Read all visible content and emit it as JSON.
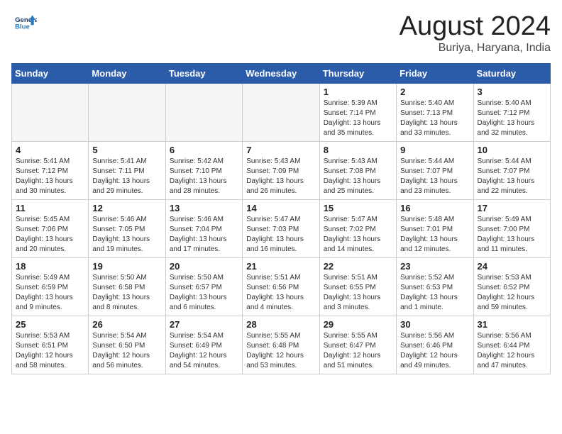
{
  "header": {
    "logo_line1": "General",
    "logo_line2": "Blue",
    "month_title": "August 2024",
    "location": "Buriya, Haryana, India"
  },
  "weekdays": [
    "Sunday",
    "Monday",
    "Tuesday",
    "Wednesday",
    "Thursday",
    "Friday",
    "Saturday"
  ],
  "weeks": [
    [
      {
        "day": "",
        "info": ""
      },
      {
        "day": "",
        "info": ""
      },
      {
        "day": "",
        "info": ""
      },
      {
        "day": "",
        "info": ""
      },
      {
        "day": "1",
        "info": "Sunrise: 5:39 AM\nSunset: 7:14 PM\nDaylight: 13 hours\nand 35 minutes."
      },
      {
        "day": "2",
        "info": "Sunrise: 5:40 AM\nSunset: 7:13 PM\nDaylight: 13 hours\nand 33 minutes."
      },
      {
        "day": "3",
        "info": "Sunrise: 5:40 AM\nSunset: 7:12 PM\nDaylight: 13 hours\nand 32 minutes."
      }
    ],
    [
      {
        "day": "4",
        "info": "Sunrise: 5:41 AM\nSunset: 7:12 PM\nDaylight: 13 hours\nand 30 minutes."
      },
      {
        "day": "5",
        "info": "Sunrise: 5:41 AM\nSunset: 7:11 PM\nDaylight: 13 hours\nand 29 minutes."
      },
      {
        "day": "6",
        "info": "Sunrise: 5:42 AM\nSunset: 7:10 PM\nDaylight: 13 hours\nand 28 minutes."
      },
      {
        "day": "7",
        "info": "Sunrise: 5:43 AM\nSunset: 7:09 PM\nDaylight: 13 hours\nand 26 minutes."
      },
      {
        "day": "8",
        "info": "Sunrise: 5:43 AM\nSunset: 7:08 PM\nDaylight: 13 hours\nand 25 minutes."
      },
      {
        "day": "9",
        "info": "Sunrise: 5:44 AM\nSunset: 7:07 PM\nDaylight: 13 hours\nand 23 minutes."
      },
      {
        "day": "10",
        "info": "Sunrise: 5:44 AM\nSunset: 7:07 PM\nDaylight: 13 hours\nand 22 minutes."
      }
    ],
    [
      {
        "day": "11",
        "info": "Sunrise: 5:45 AM\nSunset: 7:06 PM\nDaylight: 13 hours\nand 20 minutes."
      },
      {
        "day": "12",
        "info": "Sunrise: 5:46 AM\nSunset: 7:05 PM\nDaylight: 13 hours\nand 19 minutes."
      },
      {
        "day": "13",
        "info": "Sunrise: 5:46 AM\nSunset: 7:04 PM\nDaylight: 13 hours\nand 17 minutes."
      },
      {
        "day": "14",
        "info": "Sunrise: 5:47 AM\nSunset: 7:03 PM\nDaylight: 13 hours\nand 16 minutes."
      },
      {
        "day": "15",
        "info": "Sunrise: 5:47 AM\nSunset: 7:02 PM\nDaylight: 13 hours\nand 14 minutes."
      },
      {
        "day": "16",
        "info": "Sunrise: 5:48 AM\nSunset: 7:01 PM\nDaylight: 13 hours\nand 12 minutes."
      },
      {
        "day": "17",
        "info": "Sunrise: 5:49 AM\nSunset: 7:00 PM\nDaylight: 13 hours\nand 11 minutes."
      }
    ],
    [
      {
        "day": "18",
        "info": "Sunrise: 5:49 AM\nSunset: 6:59 PM\nDaylight: 13 hours\nand 9 minutes."
      },
      {
        "day": "19",
        "info": "Sunrise: 5:50 AM\nSunset: 6:58 PM\nDaylight: 13 hours\nand 8 minutes."
      },
      {
        "day": "20",
        "info": "Sunrise: 5:50 AM\nSunset: 6:57 PM\nDaylight: 13 hours\nand 6 minutes."
      },
      {
        "day": "21",
        "info": "Sunrise: 5:51 AM\nSunset: 6:56 PM\nDaylight: 13 hours\nand 4 minutes."
      },
      {
        "day": "22",
        "info": "Sunrise: 5:51 AM\nSunset: 6:55 PM\nDaylight: 13 hours\nand 3 minutes."
      },
      {
        "day": "23",
        "info": "Sunrise: 5:52 AM\nSunset: 6:53 PM\nDaylight: 13 hours\nand 1 minute."
      },
      {
        "day": "24",
        "info": "Sunrise: 5:53 AM\nSunset: 6:52 PM\nDaylight: 12 hours\nand 59 minutes."
      }
    ],
    [
      {
        "day": "25",
        "info": "Sunrise: 5:53 AM\nSunset: 6:51 PM\nDaylight: 12 hours\nand 58 minutes."
      },
      {
        "day": "26",
        "info": "Sunrise: 5:54 AM\nSunset: 6:50 PM\nDaylight: 12 hours\nand 56 minutes."
      },
      {
        "day": "27",
        "info": "Sunrise: 5:54 AM\nSunset: 6:49 PM\nDaylight: 12 hours\nand 54 minutes."
      },
      {
        "day": "28",
        "info": "Sunrise: 5:55 AM\nSunset: 6:48 PM\nDaylight: 12 hours\nand 53 minutes."
      },
      {
        "day": "29",
        "info": "Sunrise: 5:55 AM\nSunset: 6:47 PM\nDaylight: 12 hours\nand 51 minutes."
      },
      {
        "day": "30",
        "info": "Sunrise: 5:56 AM\nSunset: 6:46 PM\nDaylight: 12 hours\nand 49 minutes."
      },
      {
        "day": "31",
        "info": "Sunrise: 5:56 AM\nSunset: 6:44 PM\nDaylight: 12 hours\nand 47 minutes."
      }
    ]
  ]
}
